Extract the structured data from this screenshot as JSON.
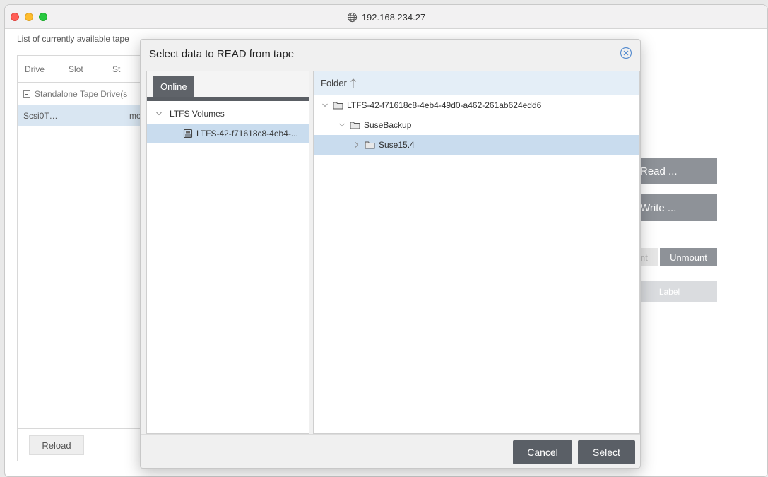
{
  "window": {
    "url": "192.168.234.27"
  },
  "background": {
    "caption": "List of currently available tape",
    "columns": [
      "Drive",
      "Slot",
      "St"
    ],
    "group_label": "Standalone Tape Drive(s",
    "row": {
      "drive": "Scsi0T…",
      "state": "mo"
    },
    "reload_label": "Reload",
    "actions": {
      "read": "Read ...",
      "write": "Write ...",
      "mount": "nt",
      "unmount": "Unmount",
      "label": "Label"
    }
  },
  "dialog": {
    "title": "Select data to READ from tape",
    "tab": "Online",
    "tree": {
      "root": "LTFS Volumes",
      "volume": "LTFS-42-f71618c8-4eb4-..."
    },
    "folder_header": "Folder",
    "folders": [
      {
        "name": "LTFS-42-f71618c8-4eb4-49d0-a462-261ab624edd6",
        "level": 0,
        "expanded": true
      },
      {
        "name": "SuseBackup",
        "level": 1,
        "expanded": true
      },
      {
        "name": "Suse15.4",
        "level": 2,
        "expanded": false,
        "selected": true
      }
    ],
    "cancel_label": "Cancel",
    "select_label": "Select"
  },
  "icons": [
    "globe-icon",
    "close-circle-icon",
    "chevron-down-icon",
    "chevron-right-icon",
    "drive-icon",
    "folder-icon",
    "sort-up-arrow-icon",
    "minus-box-icon"
  ],
  "colors": {
    "button": "#5a5f66",
    "selection": "#c9dcee",
    "action_disabled": "#8e9298"
  }
}
